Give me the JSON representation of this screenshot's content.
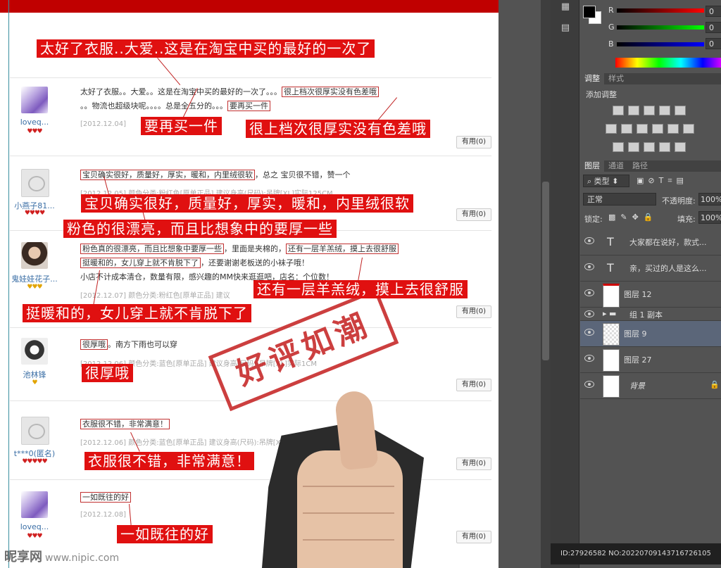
{
  "reviews": [
    {
      "user": "loveq...",
      "badges": "♥♥♥",
      "text_line1": "太好了衣服。。大爱。。这是在淘宝中买的最好的一次了。。。",
      "box1": "很上档次很厚实没有色差哦",
      "text_line2": "。。物流也超级块呢。。。。总是全五分的。。。",
      "box2": "要再买一件",
      "date": "[2012.12.04]",
      "useful": "有用(0)"
    },
    {
      "user": "小燕子81...",
      "badges": "♥♥♥♥",
      "box1": "宝贝确实很好，质量好，厚实，暖和，内里绒很软",
      "text_line1": "，总之 宝贝很不错，赞一个",
      "meta": "[2012.12.05] 颜色分类:粉红色[原单正品] 建议身高(尺码):吊牌[XL]实际125CM",
      "useful": "有用(0)"
    },
    {
      "user": "鬼娃娃花子...",
      "badges": "♥♥♥",
      "box1": "粉色真的很漂亮，而且比想象中要厚一些",
      "text_line1": "，里面是夹棉的，",
      "box2": "还有一层羊羔绒，摸上去很舒服",
      "box3": "挺暖和的，女儿穿上就不肯脱下了",
      "text_line2": "，还要谢谢老板送的小袜子哦！",
      "text_line3": "小店不计成本清仓，数量有限，感兴趣的MM快来逛逛吧，店名：个位数！",
      "meta": "[2012.12.07] 颜色分类:粉红色[原单正品] 建议",
      "useful": "有用(0)"
    },
    {
      "user": "池林锋",
      "badges": "♥",
      "box1": "很厚哦",
      "text_line1": "。南方下雨也可以穿",
      "meta": "[2012.12.06] 颜色分类:蓝色[原单正品] 建议身高(尺码):吊牌[XL]实际1CM",
      "useful": "有用(0)"
    },
    {
      "user": "t***0(匿名)",
      "badges": "♥♥♥♥♥",
      "box1": "衣服很不错，非常满意！",
      "meta": "[2012.12.06] 颜色分类:蓝色[原单正品] 建议身高(尺码):吊牌[XL]实际11",
      "useful": "有用(0)"
    },
    {
      "user": "loveq...",
      "badges": "♥♥♥",
      "box1": "一如既往的好",
      "date": "[2012.12.08]",
      "useful": "有用(0)"
    }
  ],
  "callouts": {
    "c1": "太好了衣服..大爱..这是在淘宝中买的最好的一次了",
    "c2": "要再买一件",
    "c3": "很上档次很厚实没有色差哦",
    "c4": "宝贝确实很好，质量好，厚实，暖和，内里绒很软",
    "c5": "粉色的很漂亮，而且比想象中的要厚一些",
    "c6": "还有一层羊羔绒，摸上去很舒服",
    "c7": "挺暖和的，女儿穿上就不肯脱下了",
    "c8": "很厚哦",
    "c9": "衣服很不错，非常满意！",
    "c10": "一如既往的好"
  },
  "stamp_text": "好评如潮",
  "watermark": {
    "site": "昵享网",
    "url": "www.nipic.com"
  },
  "photoshop": {
    "color_channels": [
      {
        "label": "R",
        "value": "0"
      },
      {
        "label": "G",
        "value": "0"
      },
      {
        "label": "B",
        "value": "0"
      }
    ],
    "adjust_tabs": [
      "调整",
      "样式"
    ],
    "adjust_title": "添加调整",
    "layer_tabs": [
      "图层",
      "通道",
      "路径"
    ],
    "filter_kind": "类型",
    "blend_mode": "正常",
    "opacity_label": "不透明度:",
    "opacity_value": "100%",
    "lock_label": "锁定:",
    "fill_label": "填充:",
    "fill_value": "100%",
    "layers": [
      {
        "name": "大家都在说好，款式...",
        "type": "text"
      },
      {
        "name": "亲，买过的人是这么...",
        "type": "text"
      },
      {
        "name": "图层 12",
        "type": "pixel"
      },
      {
        "name": "组 1 副本",
        "type": "group"
      },
      {
        "name": "图层 9",
        "type": "pixel"
      },
      {
        "name": "图层 27",
        "type": "pixel"
      },
      {
        "name": "背景",
        "type": "background"
      }
    ],
    "status": "ID:27926582 NO:20220709143716726105"
  },
  "colors": {
    "accent_red": "#e01010",
    "panel_bg": "#535353",
    "selected_layer": "#5b6679"
  }
}
